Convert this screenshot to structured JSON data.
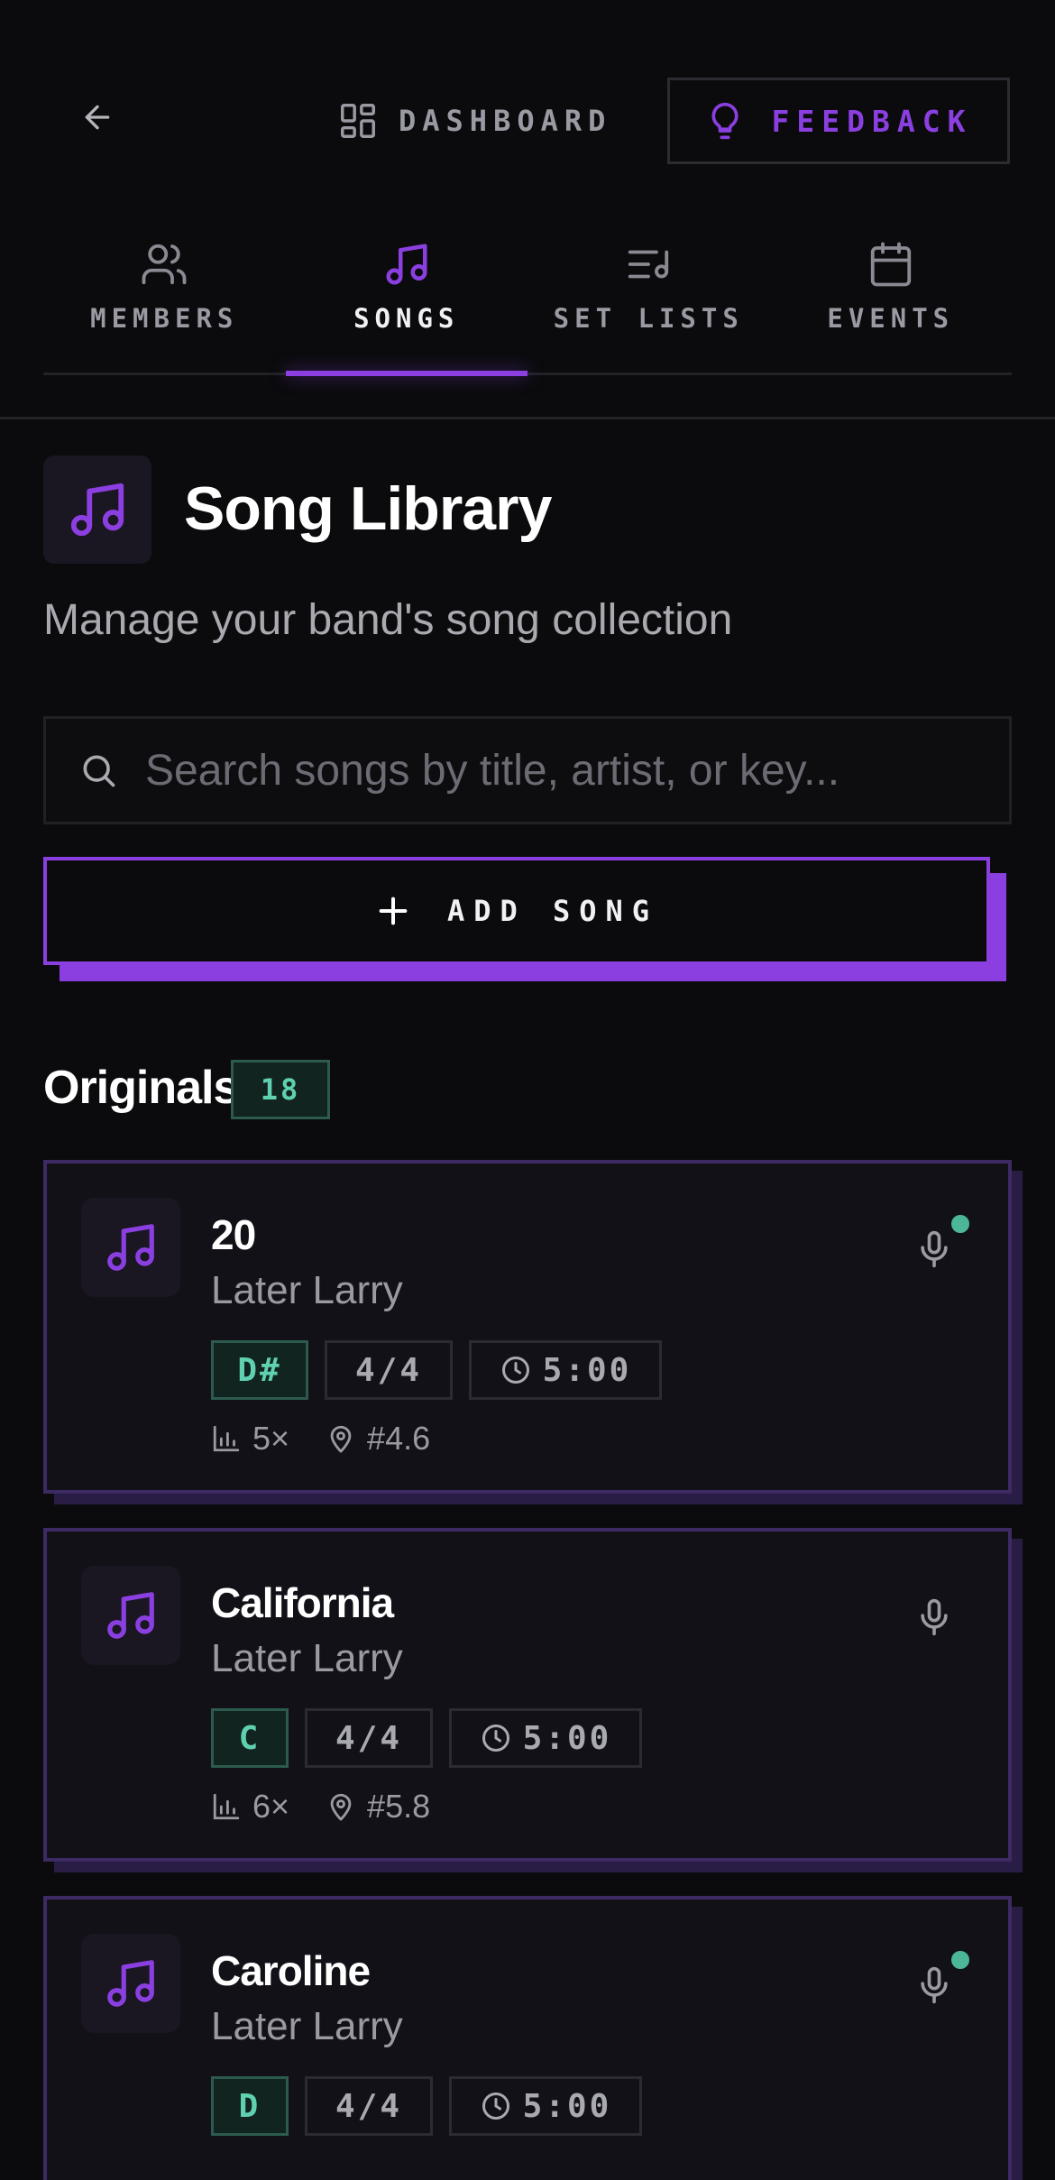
{
  "header": {
    "dashboard_label": "DASHBOARD",
    "feedback_label": "FEEDBACK"
  },
  "tabs": [
    {
      "label": "MEMBERS",
      "icon": "users-icon",
      "active": false
    },
    {
      "label": "SONGS",
      "icon": "music-note-icon",
      "active": true
    },
    {
      "label": "SET LISTS",
      "icon": "list-music-icon",
      "active": false
    },
    {
      "label": "EVENTS",
      "icon": "calendar-icon",
      "active": false
    }
  ],
  "page": {
    "title": "Song Library",
    "subtitle": "Manage your band's song collection"
  },
  "search": {
    "placeholder": "Search songs by title, artist, or key...",
    "value": ""
  },
  "add_song_label": "ADD SONG",
  "section": {
    "title": "Originals",
    "count": "18"
  },
  "songs": [
    {
      "title": "20",
      "artist": "Later Larry",
      "key": "D#",
      "time_signature": "4/4",
      "duration": "5:00",
      "plays": "5×",
      "position": "#4.6",
      "has_recording": true
    },
    {
      "title": "California",
      "artist": "Later Larry",
      "key": "C",
      "time_signature": "4/4",
      "duration": "5:00",
      "plays": "6×",
      "position": "#5.8",
      "has_recording": false
    },
    {
      "title": "Caroline",
      "artist": "Later Larry",
      "key": "D",
      "time_signature": "4/4",
      "duration": "5:00",
      "has_recording": true
    }
  ],
  "colors": {
    "accent": "#8b3fe0",
    "background": "#0b0b0d",
    "card": "#121117",
    "key_badge": "#5fd1b0",
    "recording_dot": "#4cb69a"
  }
}
